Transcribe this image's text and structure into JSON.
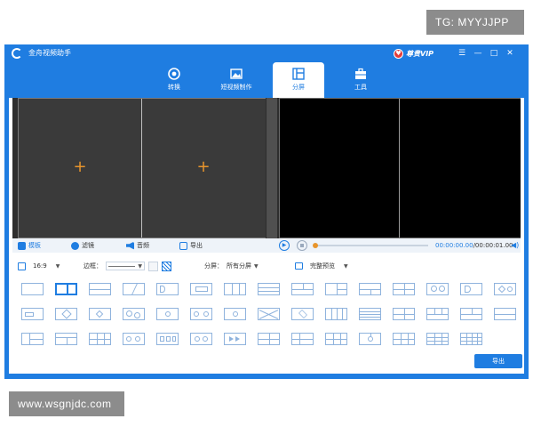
{
  "watermarks": {
    "top": "TG: MYYJJPP",
    "bottom": "www.wsgnjdc.com"
  },
  "window": {
    "title": "金舟视频助手",
    "vip_label": "尊贵VIP",
    "buttons": [
      "☰",
      "—",
      "□",
      "✕"
    ]
  },
  "tabs": [
    {
      "label": "转换",
      "icon": "convert-icon"
    },
    {
      "label": "短视频制作",
      "icon": "short-video-icon"
    },
    {
      "label": "分屏",
      "icon": "split-screen-icon",
      "active": true
    },
    {
      "label": "工具",
      "icon": "toolbox-icon"
    }
  ],
  "editor": {
    "options": [
      {
        "label": "模板",
        "icon": "template-icon",
        "active": true
      },
      {
        "label": "滤镜",
        "icon": "filter-icon"
      },
      {
        "label": "音频",
        "icon": "audio-icon"
      },
      {
        "label": "导出",
        "icon": "export-icon"
      }
    ],
    "timecode_current": "00:00:00.00",
    "timecode_total": "/00:00:01.00",
    "progress": 0
  },
  "settings": {
    "ratio": "16:9",
    "border_label": "边框：",
    "split_label": "分屏：",
    "split_value": "所有分屏",
    "preview_label": "完整预览"
  },
  "export_button": "导出",
  "colors": {
    "accent": "#1f7de1",
    "plus": "#e8952c"
  }
}
